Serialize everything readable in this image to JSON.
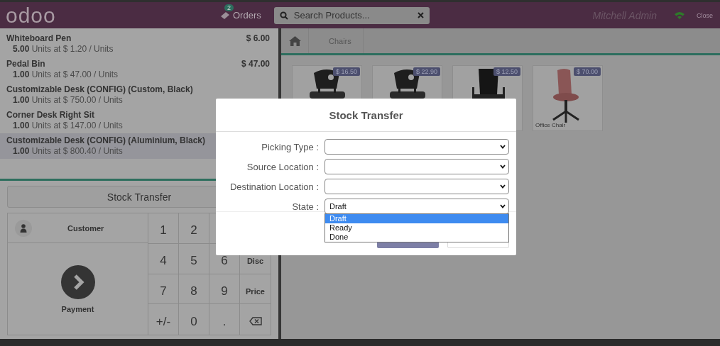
{
  "header": {
    "logo": "odoo",
    "orders": {
      "label": "Orders",
      "badge": "2"
    },
    "search": {
      "placeholder": "Search Products..."
    },
    "user": "Mitchell Admin",
    "close": "Close"
  },
  "orderlines": [
    {
      "name": "Whiteboard Pen",
      "price": "$ 6.00",
      "qty": "5.00",
      "detail": "Units at $ 1.20 / Units",
      "selected": false
    },
    {
      "name": "Pedal Bin",
      "price": "$ 47.00",
      "qty": "1.00",
      "detail": "Units at $ 47.00 / Units",
      "selected": false
    },
    {
      "name": "Customizable Desk (CONFIG) (Custom, Black)",
      "qty": "1.00",
      "detail": "Units at $ 750.00 / Units",
      "selected": false
    },
    {
      "name": "Corner Desk Right Sit",
      "qty": "1.00",
      "detail": "Units at $ 147.00 / Units",
      "selected": false
    },
    {
      "name": "Customizable Desk (CONFIG) (Aluminium, Black)",
      "qty": "1.00",
      "detail": "Units at $ 800.40 / Units",
      "selected": true
    }
  ],
  "stock_button": "Stock Transfer",
  "customer": "Customer",
  "payment": "Payment",
  "keys": [
    {
      "kind": "digit",
      "label": "1"
    },
    {
      "kind": "digit",
      "label": "2"
    },
    {
      "kind": "covered"
    },
    {
      "kind": "covered"
    },
    {
      "kind": "digit",
      "label": "4"
    },
    {
      "kind": "digit",
      "label": "5"
    },
    {
      "kind": "digit",
      "label": "6"
    },
    {
      "kind": "mode",
      "label": "Disc"
    },
    {
      "kind": "digit",
      "label": "7"
    },
    {
      "kind": "digit",
      "label": "8"
    },
    {
      "kind": "digit",
      "label": "9"
    },
    {
      "kind": "mode",
      "label": "Price"
    },
    {
      "kind": "digit",
      "label": "+/-"
    },
    {
      "kind": "digit",
      "label": "0"
    },
    {
      "kind": "digit",
      "label": "."
    },
    {
      "kind": "backspace"
    }
  ],
  "breadcrumb": {
    "category": "Chairs"
  },
  "products": [
    {
      "price": "$ 16.50",
      "kind": "stack"
    },
    {
      "price": "$ 22.90",
      "kind": "stack"
    },
    {
      "price": "$ 12.50",
      "kind": "office"
    },
    {
      "price": "$ 70.00",
      "kind": "swivel",
      "name": "Office Chair"
    }
  ],
  "dialog": {
    "title": "Stock Transfer",
    "fields": [
      {
        "label": "Picking Type :"
      },
      {
        "label": "Source Location :"
      },
      {
        "label": "Destination Location :"
      },
      {
        "label": "State :",
        "value": "Draft",
        "options": [
          {
            "label": "Draft",
            "selected": true
          },
          {
            "label": "Ready",
            "selected": false
          },
          {
            "label": "Done",
            "selected": false
          }
        ]
      }
    ]
  }
}
